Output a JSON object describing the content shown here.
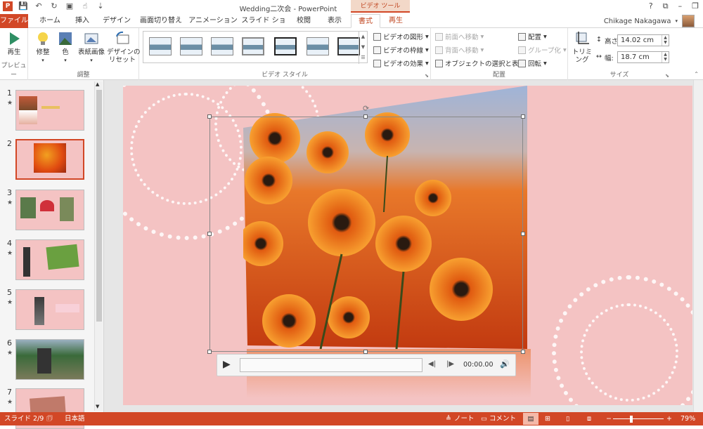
{
  "window": {
    "title": "Wedding二次会 - PowerPoint",
    "context_header": "ビデオ ツール"
  },
  "tabs": [
    {
      "label": "ファイル"
    },
    {
      "label": "ホーム"
    },
    {
      "label": "挿入"
    },
    {
      "label": "デザイン"
    },
    {
      "label": "画面切り替え"
    },
    {
      "label": "アニメーション"
    },
    {
      "label": "スライド ショー"
    },
    {
      "label": "校閲"
    },
    {
      "label": "表示"
    },
    {
      "label": "書式"
    },
    {
      "label": "再生"
    }
  ],
  "user": {
    "name": "Chikage Nakagawa"
  },
  "ribbon": {
    "preview": {
      "play_label": "再生",
      "group_label": "プレビュー"
    },
    "adjust": {
      "correct_label": "修整",
      "color_label": "色",
      "poster_label": "表紙画像",
      "reset_label": "デザインの\nリセット",
      "group_label": "調整"
    },
    "video_styles": {
      "shape_label": "ビデオの図形",
      "border_label": "ビデオの枠線",
      "effects_label": "ビデオの効果",
      "group_label": "ビデオ スタイル"
    },
    "arrange": {
      "forward_label": "前面へ移動",
      "backward_label": "背面へ移動",
      "selection_label": "オブジェクトの選択と表示",
      "align_label": "配置",
      "group_label_btn": "グループ化",
      "rotate_label": "回転",
      "group_label": "配置"
    },
    "size": {
      "crop_label": "トリミング",
      "height_label": "高さ:",
      "height_value": "14.02 cm",
      "width_label": "幅:",
      "width_value": "18.7 cm",
      "group_label": "サイズ"
    }
  },
  "slides": [
    {
      "num": "1",
      "star": "★"
    },
    {
      "num": "2",
      "star": ""
    },
    {
      "num": "3",
      "star": "★"
    },
    {
      "num": "4",
      "star": "★"
    },
    {
      "num": "5",
      "star": "★"
    },
    {
      "num": "6",
      "star": "★"
    },
    {
      "num": "7",
      "star": "★"
    }
  ],
  "player": {
    "time": "00:00.00"
  },
  "status": {
    "slide": "スライド 2/9",
    "lang": "日本語",
    "notes": "ノート",
    "comments": "コメント",
    "zoom": "79%"
  },
  "colors": {
    "accent": "#d24726",
    "slide_bg": "#f4c3c3"
  }
}
